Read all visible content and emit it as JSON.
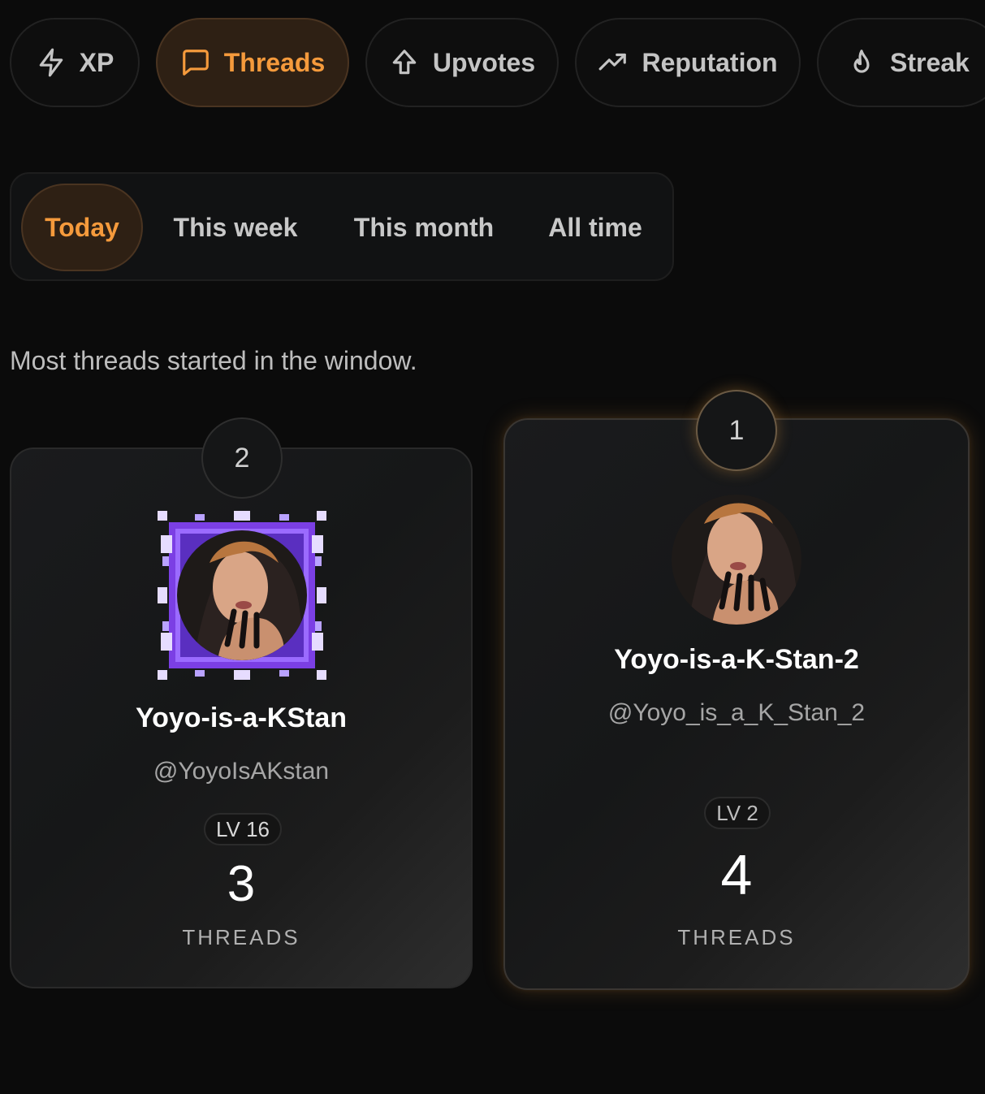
{
  "metric_tabs": [
    {
      "label": "XP",
      "icon": "lightning-icon",
      "active": false
    },
    {
      "label": "Threads",
      "icon": "message-square-icon",
      "active": true
    },
    {
      "label": "Upvotes",
      "icon": "arrow-up-icon",
      "active": false
    },
    {
      "label": "Reputation",
      "icon": "trending-up-icon",
      "active": false
    },
    {
      "label": "Streak",
      "icon": "flame-icon",
      "active": false
    }
  ],
  "time_filters": [
    {
      "label": "Today",
      "active": true
    },
    {
      "label": "This week",
      "active": false
    },
    {
      "label": "This month",
      "active": false
    },
    {
      "label": "All time",
      "active": false
    }
  ],
  "description": "Most threads started in the window.",
  "leaders": [
    {
      "rank": "2",
      "display_name": "Yoyo-is-a-KStan",
      "handle": "@YoyoIsAKstan",
      "level": "LV 16",
      "score": "3",
      "score_label": "THREADS",
      "avatar": "avatar-with-pixel-frame"
    },
    {
      "rank": "1",
      "display_name": "Yoyo-is-a-K-Stan-2",
      "handle": "@Yoyo_is_a_K_Stan_2",
      "level": "LV 2",
      "score": "4",
      "score_label": "THREADS",
      "avatar": "avatar"
    }
  ],
  "colors": {
    "accent": "#f59a3c",
    "accent_bg": "#2e2014",
    "background": "#0b0b0b",
    "card": "#1a1b1d",
    "frame_purple": "#7b3fe4"
  }
}
